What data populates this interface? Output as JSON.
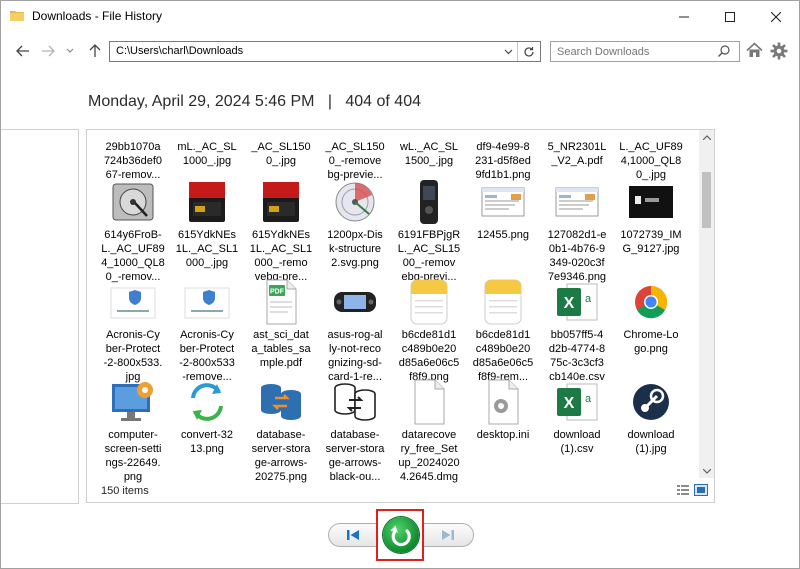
{
  "window": {
    "title": "Downloads - File History"
  },
  "address": {
    "path": "C:\\Users\\charl\\Downloads"
  },
  "search": {
    "placeholder": "Search Downloads"
  },
  "header": {
    "date": "Monday, April 29, 2024 5:46 PM",
    "separator": "|",
    "count": "404 of 404"
  },
  "status": {
    "items": "150 items"
  },
  "files": [
    {
      "label": "29bb1070a\n724b36def0\n67-remov...",
      "icon": "image-thumb"
    },
    {
      "label": "mL._AC_SL\n1000_.jpg",
      "icon": "image-thumb"
    },
    {
      "label": "_AC_SL150\n0_.jpg",
      "icon": "image-thumb"
    },
    {
      "label": "_AC_SL150\n0_-remove\nbg-previe...",
      "icon": "image-thumb"
    },
    {
      "label": "wL._AC_SL\n1500_.jpg",
      "icon": "image-thumb"
    },
    {
      "label": "df9-4e99-8\n231-d5f8ed\n9fd1b1.png",
      "icon": "image-thumb"
    },
    {
      "label": "5_NR2301L\n_V2_A.pdf",
      "icon": "pdf-file"
    },
    {
      "label": "L._AC_UF89\n4,1000_QL8\n0_.jpg",
      "icon": "image-thumb"
    },
    {
      "label": "614y6FroB-\nL._AC_UF89\n4_1000_QL8\n0_-remov...",
      "icon": "hard-drive"
    },
    {
      "label": "615YdkNEs\n1L._AC_SL1\n000_.jpg",
      "icon": "sd-card"
    },
    {
      "label": "615YdkNEs\n1L._AC_SL1\n000_-remo\nvebg-pre...",
      "icon": "sd-card"
    },
    {
      "label": "1200px-Dis\nk-structure\n2.svg.png",
      "icon": "disk-structure"
    },
    {
      "label": "6191FBPjgR\nL._AC_SL15\n00_-remov\nebg-previ...",
      "icon": "recorder"
    },
    {
      "label": "12455.png",
      "icon": "screenshot"
    },
    {
      "label": "127082d1-e\n0b1-4b76-9\n349-020c3f\n7e9346.png",
      "icon": "screenshot"
    },
    {
      "label": "1072739_IM\nG_9127.jpg",
      "icon": "photo-dark"
    },
    {
      "label": "Acronis-Cy\nber-Protect\n-2-800x533.\njpg",
      "icon": "acronis"
    },
    {
      "label": "Acronis-Cy\nber-Protect\n-2-800x533\n-remove...",
      "icon": "acronis"
    },
    {
      "label": "ast_sci_dat\na_tables_sa\nmple.pdf",
      "icon": "pdf-doc"
    },
    {
      "label": "asus-rog-al\nly-not-reco\ngnizing-sd-\ncard-1-re...",
      "icon": "handheld"
    },
    {
      "label": "b6cde81d1\nc489b0e20\nd85a6e06c5\nf8f9.png",
      "icon": "notes"
    },
    {
      "label": "b6cde81d1\nc489b0e20\nd85a6e06c5\nf8f9-rem...",
      "icon": "notes"
    },
    {
      "label": "bb057ff5-4\nd2b-4774-8\n75c-3c3cf3\ncb140e.csv",
      "icon": "excel"
    },
    {
      "label": "Chrome-Lo\ngo.png",
      "icon": "chrome"
    },
    {
      "label": "computer-\nscreen-setti\nngs-22649.\npng",
      "icon": "monitor-gear"
    },
    {
      "label": "convert-32\n13.png",
      "icon": "convert"
    },
    {
      "label": "database-\nserver-stora\nge-arrows-\n20275.png",
      "icon": "database-color"
    },
    {
      "label": "database-\nserver-stora\nge-arrows-\nblack-ou...",
      "icon": "database-outline"
    },
    {
      "label": "datarecove\nry_free_Set\nup_2024020\n4.2645.dmg",
      "icon": "blank-file"
    },
    {
      "label": "desktop.ini",
      "icon": "settings-file"
    },
    {
      "label": "download\n(1).csv",
      "icon": "excel"
    },
    {
      "label": "download\n(1).jpg",
      "icon": "steam"
    }
  ],
  "colors": {
    "restore_green": "#14a33a",
    "highlight_red": "#e0201b",
    "accent_blue": "#1b73c8"
  }
}
